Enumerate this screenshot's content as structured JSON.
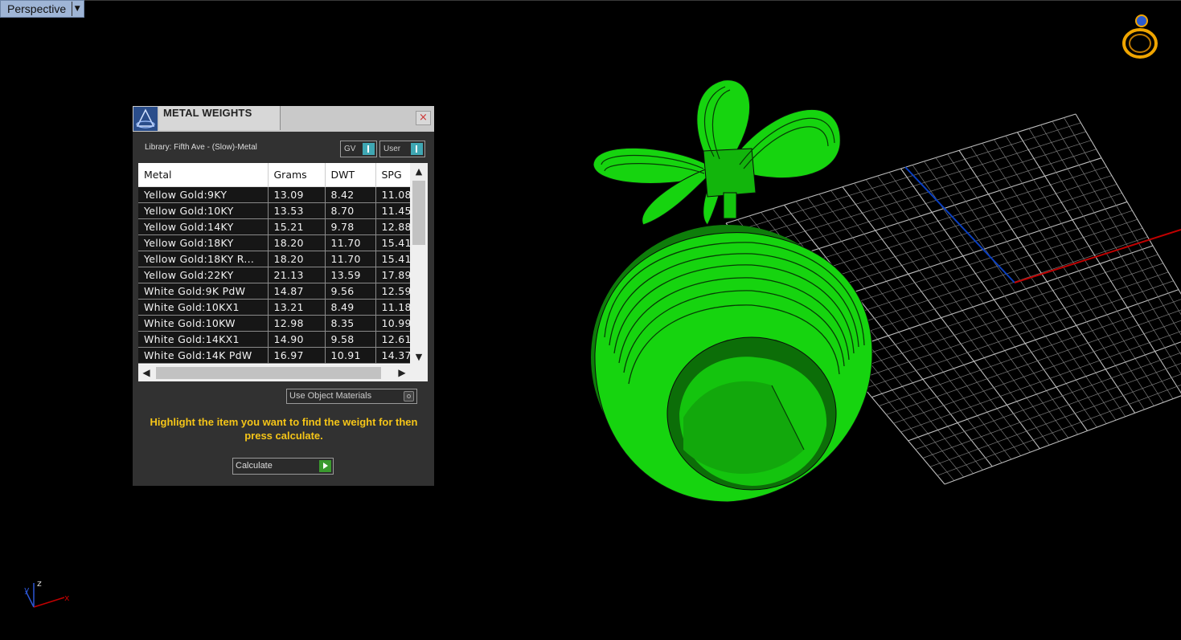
{
  "viewport": {
    "name": "Perspective",
    "axis_labels": {
      "x": "x",
      "y": "y",
      "z": "z"
    }
  },
  "dialog": {
    "title": "METAL WEIGHTS",
    "close_glyph": "×",
    "library_label": "Library: Fifth Ave - (Slow)-Metal",
    "toggle_gv": "GV",
    "toggle_user": "User",
    "columns": [
      "Metal",
      "Grams",
      "DWT",
      "SPG"
    ],
    "rows": [
      [
        "Yellow Gold:9KY",
        "13.09",
        "8.42",
        "11.08"
      ],
      [
        "Yellow Gold:10KY",
        "13.53",
        "8.70",
        "11.45"
      ],
      [
        "Yellow Gold:14KY",
        "15.21",
        "9.78",
        "12.88"
      ],
      [
        "Yellow Gold:18KY",
        "18.20",
        "11.70",
        "15.41"
      ],
      [
        "Yellow Gold:18KY R...",
        "18.20",
        "11.70",
        "15.41"
      ],
      [
        "Yellow Gold:22KY",
        "21.13",
        "13.59",
        "17.89"
      ],
      [
        "White Gold:9K PdW",
        "14.87",
        "9.56",
        "12.59"
      ],
      [
        "White Gold:10KX1",
        "13.21",
        "8.49",
        "11.18"
      ],
      [
        "White Gold:10KW",
        "12.98",
        "8.35",
        "10.99"
      ],
      [
        "White Gold:14KX1",
        "14.90",
        "9.58",
        "12.61"
      ],
      [
        "White Gold:14K PdW",
        "16.97",
        "10.91",
        "14.37"
      ]
    ],
    "use_object_materials": "Use Object Materials",
    "hint": "Highlight the item you want to find the weight for then press calculate.",
    "calculate_label": "Calculate"
  },
  "colors": {
    "model_green": "#16d40f",
    "grid_line": "#d8d8d8",
    "x_axis": "#c00000",
    "y_axis": "#0a3fc0",
    "hint_text": "#f5c518",
    "ring_icon": "#f0a500"
  }
}
